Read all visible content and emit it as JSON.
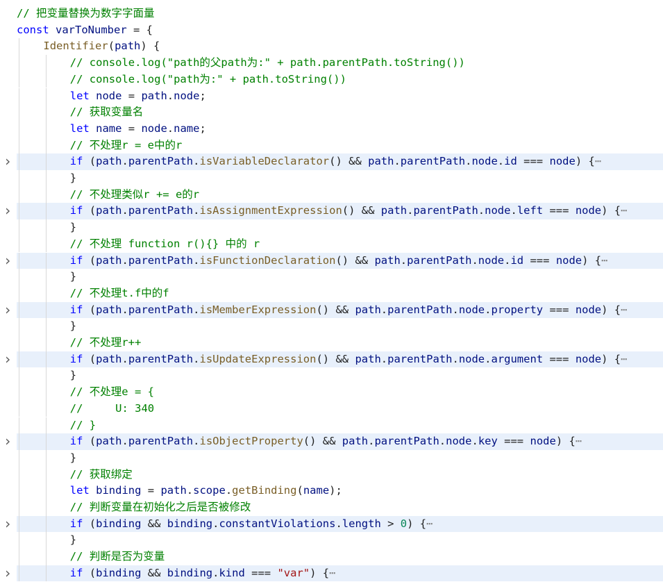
{
  "editor": {
    "lines": [
      {
        "indent": 0,
        "folded": false,
        "tokens": [
          [
            "comment",
            "// 把变量替换为数字字面量"
          ]
        ]
      },
      {
        "indent": 0,
        "folded": false,
        "tokens": [
          [
            "kw",
            "const"
          ],
          [
            "punc",
            " "
          ],
          [
            "var",
            "varToNumber"
          ],
          [
            "punc",
            " = {"
          ]
        ]
      },
      {
        "indent": 1,
        "folded": false,
        "tokens": [
          [
            "fn",
            "Identifier"
          ],
          [
            "punc",
            "("
          ],
          [
            "var",
            "path"
          ],
          [
            "punc",
            ") {"
          ]
        ]
      },
      {
        "indent": 2,
        "folded": false,
        "tokens": [
          [
            "comment",
            "// console.log(\"path的父path为:\" + path.parentPath.toString())"
          ]
        ]
      },
      {
        "indent": 2,
        "folded": false,
        "tokens": [
          [
            "comment",
            "// console.log(\"path为:\" + path.toString())"
          ]
        ]
      },
      {
        "indent": 2,
        "folded": false,
        "tokens": [
          [
            "kw",
            "let"
          ],
          [
            "punc",
            " "
          ],
          [
            "var",
            "node"
          ],
          [
            "punc",
            " = "
          ],
          [
            "var",
            "path"
          ],
          [
            "punc",
            "."
          ],
          [
            "var",
            "node"
          ],
          [
            "punc",
            ";"
          ]
        ]
      },
      {
        "indent": 2,
        "folded": false,
        "tokens": [
          [
            "comment",
            "// 获取变量名"
          ]
        ]
      },
      {
        "indent": 2,
        "folded": false,
        "tokens": [
          [
            "kw",
            "let"
          ],
          [
            "punc",
            " "
          ],
          [
            "var",
            "name"
          ],
          [
            "punc",
            " = "
          ],
          [
            "var",
            "node"
          ],
          [
            "punc",
            "."
          ],
          [
            "var",
            "name"
          ],
          [
            "punc",
            ";"
          ]
        ]
      },
      {
        "indent": 2,
        "folded": false,
        "tokens": [
          [
            "comment",
            "// 不处理r = e中的r"
          ]
        ]
      },
      {
        "indent": 2,
        "folded": true,
        "tokens": [
          [
            "kw",
            "if"
          ],
          [
            "punc",
            " ("
          ],
          [
            "var",
            "path"
          ],
          [
            "punc",
            "."
          ],
          [
            "var",
            "parentPath"
          ],
          [
            "punc",
            "."
          ],
          [
            "fn",
            "isVariableDeclarator"
          ],
          [
            "punc",
            "() && "
          ],
          [
            "var",
            "path"
          ],
          [
            "punc",
            "."
          ],
          [
            "var",
            "parentPath"
          ],
          [
            "punc",
            "."
          ],
          [
            "var",
            "node"
          ],
          [
            "punc",
            "."
          ],
          [
            "var",
            "id"
          ],
          [
            "punc",
            " === "
          ],
          [
            "var",
            "node"
          ],
          [
            "punc",
            ") {"
          ],
          [
            "ellipsis",
            "⋯"
          ]
        ]
      },
      {
        "indent": 2,
        "folded": false,
        "tokens": [
          [
            "punc",
            "}"
          ]
        ]
      },
      {
        "indent": 2,
        "folded": false,
        "tokens": [
          [
            "comment",
            "// 不处理类似r += e的r"
          ]
        ]
      },
      {
        "indent": 2,
        "folded": true,
        "tokens": [
          [
            "kw",
            "if"
          ],
          [
            "punc",
            " ("
          ],
          [
            "var",
            "path"
          ],
          [
            "punc",
            "."
          ],
          [
            "var",
            "parentPath"
          ],
          [
            "punc",
            "."
          ],
          [
            "fn",
            "isAssignmentExpression"
          ],
          [
            "punc",
            "() && "
          ],
          [
            "var",
            "path"
          ],
          [
            "punc",
            "."
          ],
          [
            "var",
            "parentPath"
          ],
          [
            "punc",
            "."
          ],
          [
            "var",
            "node"
          ],
          [
            "punc",
            "."
          ],
          [
            "var",
            "left"
          ],
          [
            "punc",
            " === "
          ],
          [
            "var",
            "node"
          ],
          [
            "punc",
            ") {"
          ],
          [
            "ellipsis",
            "⋯"
          ]
        ]
      },
      {
        "indent": 2,
        "folded": false,
        "tokens": [
          [
            "punc",
            "}"
          ]
        ]
      },
      {
        "indent": 2,
        "folded": false,
        "tokens": [
          [
            "comment",
            "// 不处理 function r(){} 中的 r"
          ]
        ]
      },
      {
        "indent": 2,
        "folded": true,
        "tokens": [
          [
            "kw",
            "if"
          ],
          [
            "punc",
            " ("
          ],
          [
            "var",
            "path"
          ],
          [
            "punc",
            "."
          ],
          [
            "var",
            "parentPath"
          ],
          [
            "punc",
            "."
          ],
          [
            "fn",
            "isFunctionDeclaration"
          ],
          [
            "punc",
            "() && "
          ],
          [
            "var",
            "path"
          ],
          [
            "punc",
            "."
          ],
          [
            "var",
            "parentPath"
          ],
          [
            "punc",
            "."
          ],
          [
            "var",
            "node"
          ],
          [
            "punc",
            "."
          ],
          [
            "var",
            "id"
          ],
          [
            "punc",
            " === "
          ],
          [
            "var",
            "node"
          ],
          [
            "punc",
            ") {"
          ],
          [
            "ellipsis",
            "⋯"
          ]
        ]
      },
      {
        "indent": 2,
        "folded": false,
        "tokens": [
          [
            "punc",
            "}"
          ]
        ]
      },
      {
        "indent": 2,
        "folded": false,
        "tokens": [
          [
            "comment",
            "// 不处理t.f中的f"
          ]
        ]
      },
      {
        "indent": 2,
        "folded": true,
        "tokens": [
          [
            "kw",
            "if"
          ],
          [
            "punc",
            " ("
          ],
          [
            "var",
            "path"
          ],
          [
            "punc",
            "."
          ],
          [
            "var",
            "parentPath"
          ],
          [
            "punc",
            "."
          ],
          [
            "fn",
            "isMemberExpression"
          ],
          [
            "punc",
            "() && "
          ],
          [
            "var",
            "path"
          ],
          [
            "punc",
            "."
          ],
          [
            "var",
            "parentPath"
          ],
          [
            "punc",
            "."
          ],
          [
            "var",
            "node"
          ],
          [
            "punc",
            "."
          ],
          [
            "var",
            "property"
          ],
          [
            "punc",
            " === "
          ],
          [
            "var",
            "node"
          ],
          [
            "punc",
            ") {"
          ],
          [
            "ellipsis",
            "⋯"
          ]
        ]
      },
      {
        "indent": 2,
        "folded": false,
        "tokens": [
          [
            "punc",
            "}"
          ]
        ]
      },
      {
        "indent": 2,
        "folded": false,
        "tokens": [
          [
            "comment",
            "// 不处理r++"
          ]
        ]
      },
      {
        "indent": 2,
        "folded": true,
        "tokens": [
          [
            "kw",
            "if"
          ],
          [
            "punc",
            " ("
          ],
          [
            "var",
            "path"
          ],
          [
            "punc",
            "."
          ],
          [
            "var",
            "parentPath"
          ],
          [
            "punc",
            "."
          ],
          [
            "fn",
            "isUpdateExpression"
          ],
          [
            "punc",
            "() && "
          ],
          [
            "var",
            "path"
          ],
          [
            "punc",
            "."
          ],
          [
            "var",
            "parentPath"
          ],
          [
            "punc",
            "."
          ],
          [
            "var",
            "node"
          ],
          [
            "punc",
            "."
          ],
          [
            "var",
            "argument"
          ],
          [
            "punc",
            " === "
          ],
          [
            "var",
            "node"
          ],
          [
            "punc",
            ") {"
          ],
          [
            "ellipsis",
            "⋯"
          ]
        ]
      },
      {
        "indent": 2,
        "folded": false,
        "tokens": [
          [
            "punc",
            "}"
          ]
        ]
      },
      {
        "indent": 2,
        "folded": false,
        "tokens": [
          [
            "comment",
            "// 不处理e = {"
          ]
        ]
      },
      {
        "indent": 2,
        "folded": false,
        "tokens": [
          [
            "comment",
            "//     U: 340"
          ]
        ]
      },
      {
        "indent": 2,
        "folded": false,
        "tokens": [
          [
            "comment",
            "// }"
          ]
        ]
      },
      {
        "indent": 2,
        "folded": true,
        "tokens": [
          [
            "kw",
            "if"
          ],
          [
            "punc",
            " ("
          ],
          [
            "var",
            "path"
          ],
          [
            "punc",
            "."
          ],
          [
            "var",
            "parentPath"
          ],
          [
            "punc",
            "."
          ],
          [
            "fn",
            "isObjectProperty"
          ],
          [
            "punc",
            "() && "
          ],
          [
            "var",
            "path"
          ],
          [
            "punc",
            "."
          ],
          [
            "var",
            "parentPath"
          ],
          [
            "punc",
            "."
          ],
          [
            "var",
            "node"
          ],
          [
            "punc",
            "."
          ],
          [
            "var",
            "key"
          ],
          [
            "punc",
            " === "
          ],
          [
            "var",
            "node"
          ],
          [
            "punc",
            ") {"
          ],
          [
            "ellipsis",
            "⋯"
          ]
        ]
      },
      {
        "indent": 2,
        "folded": false,
        "tokens": [
          [
            "punc",
            "}"
          ]
        ]
      },
      {
        "indent": 2,
        "folded": false,
        "tokens": [
          [
            "comment",
            "// 获取绑定"
          ]
        ]
      },
      {
        "indent": 2,
        "folded": false,
        "tokens": [
          [
            "kw",
            "let"
          ],
          [
            "punc",
            " "
          ],
          [
            "var",
            "binding"
          ],
          [
            "punc",
            " = "
          ],
          [
            "var",
            "path"
          ],
          [
            "punc",
            "."
          ],
          [
            "var",
            "scope"
          ],
          [
            "punc",
            "."
          ],
          [
            "fn",
            "getBinding"
          ],
          [
            "punc",
            "("
          ],
          [
            "var",
            "name"
          ],
          [
            "punc",
            ");"
          ]
        ]
      },
      {
        "indent": 2,
        "folded": false,
        "tokens": [
          [
            "comment",
            "// 判断变量在初始化之后是否被修改"
          ]
        ]
      },
      {
        "indent": 2,
        "folded": true,
        "tokens": [
          [
            "kw",
            "if"
          ],
          [
            "punc",
            " ("
          ],
          [
            "var",
            "binding"
          ],
          [
            "punc",
            " && "
          ],
          [
            "var",
            "binding"
          ],
          [
            "punc",
            "."
          ],
          [
            "var",
            "constantViolations"
          ],
          [
            "punc",
            "."
          ],
          [
            "var",
            "length"
          ],
          [
            "punc",
            " > "
          ],
          [
            "num",
            "0"
          ],
          [
            "punc",
            ") {"
          ],
          [
            "ellipsis",
            "⋯"
          ]
        ]
      },
      {
        "indent": 2,
        "folded": false,
        "tokens": [
          [
            "punc",
            "}"
          ]
        ]
      },
      {
        "indent": 2,
        "folded": false,
        "tokens": [
          [
            "comment",
            "// 判断是否为变量"
          ]
        ]
      },
      {
        "indent": 2,
        "folded": true,
        "tokens": [
          [
            "kw",
            "if"
          ],
          [
            "punc",
            " ("
          ],
          [
            "var",
            "binding"
          ],
          [
            "punc",
            " && "
          ],
          [
            "var",
            "binding"
          ],
          [
            "punc",
            "."
          ],
          [
            "var",
            "kind"
          ],
          [
            "punc",
            " === "
          ],
          [
            "str",
            "\"var\""
          ],
          [
            "punc",
            ") {"
          ],
          [
            "ellipsis",
            "⋯"
          ]
        ]
      }
    ],
    "fold_icon": "chevron-right-icon",
    "colors": {
      "comment": "#008000",
      "keyword": "#0000ff",
      "variable": "#001080",
      "function": "#795e26",
      "string": "#a31515",
      "number": "#098658",
      "folded_highlight": "#e8f0fb"
    }
  }
}
